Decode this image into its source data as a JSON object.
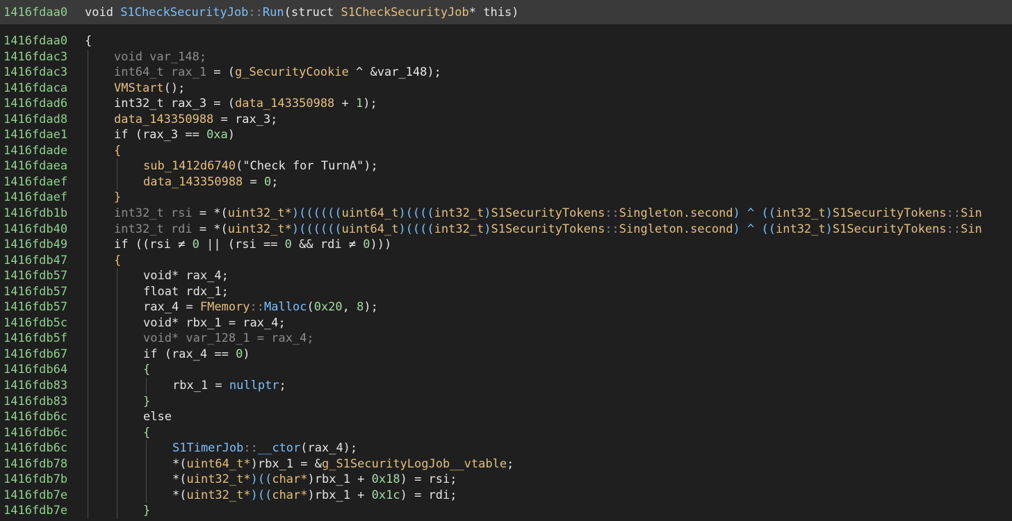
{
  "header": {
    "address": "1416fdaa0",
    "tokens": [
      {
        "t": "void ",
        "c": "pl"
      },
      {
        "t": "S1CheckSecurityJob",
        "c": "fn"
      },
      {
        "t": "::",
        "c": "dim"
      },
      {
        "t": "Run",
        "c": "fn"
      },
      {
        "t": "(",
        "c": "pl"
      },
      {
        "t": "struct ",
        "c": "pl"
      },
      {
        "t": "S1CheckSecurityJob",
        "c": "cls"
      },
      {
        "t": "* this)",
        "c": "pl"
      }
    ]
  },
  "lines": [
    {
      "addr": "1416fdaa0",
      "indent": 0,
      "tokens": [
        {
          "t": "{",
          "c": "pl"
        }
      ]
    },
    {
      "addr": "1416fdac3",
      "indent": 1,
      "tokens": [
        {
          "t": "void var_148;",
          "c": "dim"
        }
      ]
    },
    {
      "addr": "1416fdac3",
      "indent": 1,
      "tokens": [
        {
          "t": "int64_t rax_1",
          "c": "dim"
        },
        {
          "t": " = (",
          "c": "pl"
        },
        {
          "t": "g_SecurityCookie",
          "c": "cls"
        },
        {
          "t": " ^ &var_148);",
          "c": "pl"
        }
      ]
    },
    {
      "addr": "1416fdaca",
      "indent": 1,
      "tokens": [
        {
          "t": "VMStart",
          "c": "cls"
        },
        {
          "t": "();",
          "c": "pl"
        }
      ]
    },
    {
      "addr": "1416fdad6",
      "indent": 1,
      "tokens": [
        {
          "t": "int32_t rax_3 = (",
          "c": "pl"
        },
        {
          "t": "data_143350988",
          "c": "cls"
        },
        {
          "t": " + ",
          "c": "pl"
        },
        {
          "t": "1",
          "c": "num"
        },
        {
          "t": ");",
          "c": "pl"
        }
      ]
    },
    {
      "addr": "1416fdad8",
      "indent": 1,
      "tokens": [
        {
          "t": "data_143350988",
          "c": "cls"
        },
        {
          "t": " = rax_3;",
          "c": "pl"
        }
      ]
    },
    {
      "addr": "1416fdae1",
      "indent": 1,
      "tokens": [
        {
          "t": "if (rax_3 == ",
          "c": "pl"
        },
        {
          "t": "0xa",
          "c": "num"
        },
        {
          "t": ")",
          "c": "pl"
        }
      ]
    },
    {
      "addr": "1416fdade",
      "indent": 1,
      "tokens": [
        {
          "t": "{",
          "c": "cls"
        }
      ]
    },
    {
      "addr": "1416fdaea",
      "indent": 2,
      "tokens": [
        {
          "t": "sub_1412d6740",
          "c": "cls"
        },
        {
          "t": "(\"Check for TurnA\");",
          "c": "pl"
        }
      ]
    },
    {
      "addr": "1416fdaef",
      "indent": 2,
      "tokens": [
        {
          "t": "data_143350988",
          "c": "cls"
        },
        {
          "t": " = ",
          "c": "pl"
        },
        {
          "t": "0",
          "c": "num"
        },
        {
          "t": ";",
          "c": "pl"
        }
      ]
    },
    {
      "addr": "1416fdaef",
      "indent": 1,
      "tokens": [
        {
          "t": "}",
          "c": "cls"
        }
      ]
    },
    {
      "addr": "1416fdb1b",
      "indent": 1,
      "tokens": [
        {
          "t": "int32_t rsi",
          "c": "dim"
        },
        {
          "t": " = *(",
          "c": "pl"
        },
        {
          "t": "uint32_t*",
          "c": "cls"
        },
        {
          "t": ")((((((",
          "c": "tk"
        },
        {
          "t": "uint64_t",
          "c": "cls"
        },
        {
          "t": ")((((",
          "c": "tk"
        },
        {
          "t": "int32_t",
          "c": "cls"
        },
        {
          "t": ")",
          "c": "tk"
        },
        {
          "t": "S1SecurityTokens",
          "c": "cls"
        },
        {
          "t": "::",
          "c": "dim"
        },
        {
          "t": "Singleton.second",
          "c": "cls"
        },
        {
          "t": ") ^ ((",
          "c": "tk"
        },
        {
          "t": "int32_t",
          "c": "cls"
        },
        {
          "t": ")",
          "c": "tk"
        },
        {
          "t": "S1SecurityTokens",
          "c": "cls"
        },
        {
          "t": "::",
          "c": "dim"
        },
        {
          "t": "Sin",
          "c": "cls"
        }
      ]
    },
    {
      "addr": "1416fdb40",
      "indent": 1,
      "tokens": [
        {
          "t": "int32_t rdi",
          "c": "dim"
        },
        {
          "t": " = *(",
          "c": "pl"
        },
        {
          "t": "uint32_t*",
          "c": "cls"
        },
        {
          "t": ")((((((",
          "c": "tk"
        },
        {
          "t": "uint64_t",
          "c": "cls"
        },
        {
          "t": ")((((",
          "c": "tk"
        },
        {
          "t": "int32_t",
          "c": "cls"
        },
        {
          "t": ")",
          "c": "tk"
        },
        {
          "t": "S1SecurityTokens",
          "c": "cls"
        },
        {
          "t": "::",
          "c": "dim"
        },
        {
          "t": "Singleton.second",
          "c": "cls"
        },
        {
          "t": ") ^ ((",
          "c": "tk"
        },
        {
          "t": "int32_t",
          "c": "cls"
        },
        {
          "t": ")",
          "c": "tk"
        },
        {
          "t": "S1SecurityTokens",
          "c": "cls"
        },
        {
          "t": "::",
          "c": "dim"
        },
        {
          "t": "Sin",
          "c": "cls"
        }
      ]
    },
    {
      "addr": "1416fdb49",
      "indent": 1,
      "tokens": [
        {
          "t": "if ((rsi ≠ ",
          "c": "pl"
        },
        {
          "t": "0",
          "c": "num"
        },
        {
          "t": " || (rsi == ",
          "c": "pl"
        },
        {
          "t": "0",
          "c": "num"
        },
        {
          "t": " && rdi ≠ ",
          "c": "pl"
        },
        {
          "t": "0",
          "c": "num"
        },
        {
          "t": ")))",
          "c": "pl"
        }
      ]
    },
    {
      "addr": "1416fdb47",
      "indent": 1,
      "tokens": [
        {
          "t": "{",
          "c": "cls"
        }
      ]
    },
    {
      "addr": "1416fdb57",
      "indent": 2,
      "tokens": [
        {
          "t": "void* rax_4;",
          "c": "pl"
        }
      ]
    },
    {
      "addr": "1416fdb57",
      "indent": 2,
      "tokens": [
        {
          "t": "float rdx_1;",
          "c": "pl"
        }
      ]
    },
    {
      "addr": "1416fdb57",
      "indent": 2,
      "tokens": [
        {
          "t": "rax_4 = ",
          "c": "pl"
        },
        {
          "t": "FMemory",
          "c": "cls"
        },
        {
          "t": "::",
          "c": "dim"
        },
        {
          "t": "Malloc",
          "c": "fn"
        },
        {
          "t": "(",
          "c": "pl"
        },
        {
          "t": "0x20",
          "c": "num"
        },
        {
          "t": ", ",
          "c": "pl"
        },
        {
          "t": "8",
          "c": "num"
        },
        {
          "t": ");",
          "c": "pl"
        }
      ]
    },
    {
      "addr": "1416fdb5c",
      "indent": 2,
      "tokens": [
        {
          "t": "void* rbx_1 = rax_4;",
          "c": "pl"
        }
      ]
    },
    {
      "addr": "1416fdb5f",
      "indent": 2,
      "tokens": [
        {
          "t": "void* var_128_1 = rax_4;",
          "c": "dim"
        }
      ]
    },
    {
      "addr": "1416fdb67",
      "indent": 2,
      "tokens": [
        {
          "t": "if (rax_4 == ",
          "c": "pl"
        },
        {
          "t": "0",
          "c": "num"
        },
        {
          "t": ")",
          "c": "pl"
        }
      ]
    },
    {
      "addr": "1416fdb64",
      "indent": 2,
      "tokens": [
        {
          "t": "{",
          "c": "num"
        }
      ]
    },
    {
      "addr": "1416fdb83",
      "indent": 3,
      "tokens": [
        {
          "t": "rbx_1 = ",
          "c": "pl"
        },
        {
          "t": "nullptr",
          "c": "fn"
        },
        {
          "t": ";",
          "c": "pl"
        }
      ]
    },
    {
      "addr": "1416fdb83",
      "indent": 2,
      "tokens": [
        {
          "t": "}",
          "c": "num"
        }
      ]
    },
    {
      "addr": "1416fdb6c",
      "indent": 2,
      "tokens": [
        {
          "t": "else",
          "c": "pl"
        }
      ]
    },
    {
      "addr": "1416fdb6c",
      "indent": 2,
      "tokens": [
        {
          "t": "{",
          "c": "num"
        }
      ]
    },
    {
      "addr": "1416fdb6c",
      "indent": 3,
      "tokens": [
        {
          "t": "S1TimerJob",
          "c": "fn"
        },
        {
          "t": "::",
          "c": "dim"
        },
        {
          "t": "__ctor",
          "c": "fn"
        },
        {
          "t": "(rax_4);",
          "c": "pl"
        }
      ]
    },
    {
      "addr": "1416fdb78",
      "indent": 3,
      "tokens": [
        {
          "t": "*(",
          "c": "pl"
        },
        {
          "t": "uint64_t*",
          "c": "cls"
        },
        {
          "t": ")rbx_1 = &",
          "c": "pl"
        },
        {
          "t": "g_S1SecurityLogJob__vtable",
          "c": "cls"
        },
        {
          "t": ";",
          "c": "pl"
        }
      ]
    },
    {
      "addr": "1416fdb7b",
      "indent": 3,
      "tokens": [
        {
          "t": "*(",
          "c": "pl"
        },
        {
          "t": "uint32_t*",
          "c": "cls"
        },
        {
          "t": ")((",
          "c": "tk"
        },
        {
          "t": "char*",
          "c": "cls"
        },
        {
          "t": ")rbx_1 + ",
          "c": "pl"
        },
        {
          "t": "0x18",
          "c": "num"
        },
        {
          "t": ") = rsi;",
          "c": "pl"
        }
      ]
    },
    {
      "addr": "1416fdb7e",
      "indent": 3,
      "tokens": [
        {
          "t": "*(",
          "c": "pl"
        },
        {
          "t": "uint32_t*",
          "c": "cls"
        },
        {
          "t": ")((",
          "c": "tk"
        },
        {
          "t": "char*",
          "c": "cls"
        },
        {
          "t": ")rbx_1 + ",
          "c": "pl"
        },
        {
          "t": "0x1c",
          "c": "num"
        },
        {
          "t": ") = rdi;",
          "c": "pl"
        }
      ]
    },
    {
      "addr": "1416fdb7e",
      "indent": 2,
      "tokens": [
        {
          "t": "}",
          "c": "num"
        }
      ]
    }
  ]
}
